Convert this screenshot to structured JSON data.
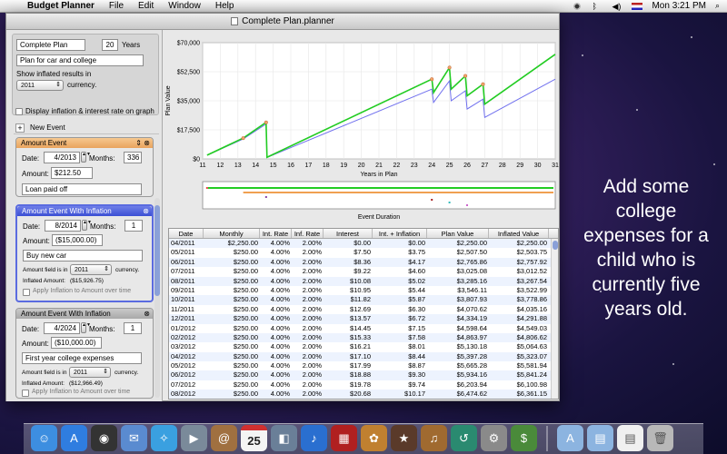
{
  "menubar": {
    "app_name": "Budget Planner",
    "items": [
      "File",
      "Edit",
      "Window",
      "Help"
    ],
    "clock": "Mon 3:21 PM"
  },
  "window": {
    "title": "Complete Plan.planner"
  },
  "plan": {
    "name": "Complete Plan",
    "years_value": "20",
    "years_label": "Years",
    "description": "Plan for car and college",
    "inflated_label": "Show inflated results in",
    "inflated_year": "2011",
    "currency_label": "currency.",
    "display_inflation_label": "Display inflation & interest rate on graph",
    "new_event_label": "New Event"
  },
  "events": [
    {
      "type": "Amount Event",
      "date_label": "Date:",
      "date": "4/2013",
      "months_label": "Months:",
      "months": "336",
      "amount_label": "Amount:",
      "amount": "$212.50",
      "description": "Loan paid off"
    },
    {
      "type": "Amount Event With Inflation",
      "date_label": "Date:",
      "date": "8/2014",
      "months_label": "Months:",
      "months": "1",
      "amount_label": "Amount:",
      "amount": "($15,000.00)",
      "description": "Buy new car",
      "field_in_label": "Amount field is in",
      "field_year": "2011",
      "currency_label": "currency.",
      "inflated_amount_label": "Inflated Amount:",
      "inflated_amount": "($15,926.75)",
      "apply_label": "Apply Inflation to Amount over time"
    },
    {
      "type": "Amount Event With Inflation",
      "date_label": "Date:",
      "date": "4/2024",
      "months_label": "Months:",
      "months": "1",
      "amount_label": "Amount:",
      "amount": "($10,000.00)",
      "description": "First year college expenses",
      "field_in_label": "Amount field is in",
      "field_year": "2011",
      "currency_label": "currency.",
      "inflated_amount_label": "Inflated Amount:",
      "inflated_amount": "($12,966.49)",
      "apply_label": "Apply Inflation to Amount over time"
    }
  ],
  "chart_data": {
    "type": "line",
    "title": "",
    "xlabel": "Years in Plan",
    "ylabel": "Plan Value",
    "xlim": [
      11,
      31
    ],
    "ylim": [
      0,
      70000
    ],
    "x_ticks": [
      "11",
      "12",
      "13",
      "14",
      "15",
      "16",
      "17",
      "18",
      "19",
      "20",
      "21",
      "22",
      "23",
      "24",
      "25",
      "26",
      "27",
      "28",
      "29",
      "30",
      "31"
    ],
    "y_ticks": [
      "$0",
      "$17,500",
      "$35,000",
      "$52,500",
      "$70,000"
    ],
    "grid": true,
    "series": [
      {
        "color": "#22cc22",
        "x": [
          11.25,
          13.3,
          14.6,
          14.65,
          24.0,
          24.1,
          25.0,
          25.1,
          25.9,
          26.0,
          26.9,
          27.0,
          31.0
        ],
        "y": [
          2250,
          12500,
          22000,
          1000,
          48000,
          40000,
          55000,
          42000,
          50000,
          38000,
          45000,
          33000,
          63000
        ]
      },
      {
        "color": "#7070ee",
        "x": [
          11.25,
          13.3,
          14.6,
          14.65,
          24.0,
          24.1,
          25.0,
          25.1,
          25.9,
          26.0,
          26.9,
          27.0,
          31.0
        ],
        "y": [
          2250,
          12000,
          21000,
          900,
          42000,
          34000,
          47000,
          35000,
          41000,
          30000,
          36000,
          25000,
          48000
        ]
      }
    ],
    "event_chart": {
      "xlabel": "Event Duration"
    }
  },
  "table": {
    "columns": [
      "Date",
      "Monthly",
      "Int. Rate",
      "Inf. Rate",
      "Interest",
      "Int. + Inflation",
      "Plan Value",
      "Inflated Value"
    ],
    "rows": [
      [
        "04/2011",
        "$2,250.00",
        "4.00%",
        "2.00%",
        "$0.00",
        "$0.00",
        "$2,250.00",
        "$2,250.00"
      ],
      [
        "05/2011",
        "$250.00",
        "4.00%",
        "2.00%",
        "$7.50",
        "$3.75",
        "$2,507.50",
        "$2,503.75"
      ],
      [
        "06/2011",
        "$250.00",
        "4.00%",
        "2.00%",
        "$8.36",
        "$4.17",
        "$2,765.86",
        "$2,757.92"
      ],
      [
        "07/2011",
        "$250.00",
        "4.00%",
        "2.00%",
        "$9.22",
        "$4.60",
        "$3,025.08",
        "$3,012.52"
      ],
      [
        "08/2011",
        "$250.00",
        "4.00%",
        "2.00%",
        "$10.08",
        "$5.02",
        "$3,285.16",
        "$3,267.54"
      ],
      [
        "09/2011",
        "$250.00",
        "4.00%",
        "2.00%",
        "$10.95",
        "$5.44",
        "$3,546.11",
        "$3,522.99"
      ],
      [
        "10/2011",
        "$250.00",
        "4.00%",
        "2.00%",
        "$11.82",
        "$5.87",
        "$3,807.93",
        "$3,778.86"
      ],
      [
        "11/2011",
        "$250.00",
        "4.00%",
        "2.00%",
        "$12.69",
        "$6.30",
        "$4,070.62",
        "$4,035.16"
      ],
      [
        "12/2011",
        "$250.00",
        "4.00%",
        "2.00%",
        "$13.57",
        "$6.72",
        "$4,334.19",
        "$4,291.88"
      ],
      [
        "01/2012",
        "$250.00",
        "4.00%",
        "2.00%",
        "$14.45",
        "$7.15",
        "$4,598.64",
        "$4,549.03"
      ],
      [
        "02/2012",
        "$250.00",
        "4.00%",
        "2.00%",
        "$15.33",
        "$7.58",
        "$4,863.97",
        "$4,806.62"
      ],
      [
        "03/2012",
        "$250.00",
        "4.00%",
        "2.00%",
        "$16.21",
        "$8.01",
        "$5,130.18",
        "$5,064.63"
      ],
      [
        "04/2012",
        "$250.00",
        "4.00%",
        "2.00%",
        "$17.10",
        "$8.44",
        "$5,397.28",
        "$5,323.07"
      ],
      [
        "05/2012",
        "$250.00",
        "4.00%",
        "2.00%",
        "$17.99",
        "$8.87",
        "$5,665.28",
        "$5,581.94"
      ],
      [
        "06/2012",
        "$250.00",
        "4.00%",
        "2.00%",
        "$18.88",
        "$9.30",
        "$5,934.16",
        "$5,841.24"
      ],
      [
        "07/2012",
        "$250.00",
        "4.00%",
        "2.00%",
        "$19.78",
        "$9.74",
        "$6,203.94",
        "$6,100.98"
      ],
      [
        "08/2012",
        "$250.00",
        "4.00%",
        "2.00%",
        "$20.68",
        "$10.17",
        "$6,474.62",
        "$6,361.15"
      ],
      [
        "09/2012",
        "$250.00",
        "4.00%",
        "2.00%",
        "$21.58",
        "$10.60",
        "$6,746.20",
        "$6,621.75"
      ],
      [
        "10/2012",
        "$250.00",
        "4.00%",
        "2.00%",
        "$22.49",
        "$11.04",
        "$7,018.69",
        "$6,882.79"
      ]
    ]
  },
  "caption": [
    "Add some",
    "college",
    "expenses for a",
    "child who is",
    "currently five",
    "years old."
  ],
  "dock": {
    "items": [
      "finder-icon",
      "app-store-icon",
      "dashboard-icon",
      "mail-icon",
      "safari-icon",
      "facetime-icon",
      "address-book-icon",
      "ical-icon",
      "preview-icon",
      "itunes-icon",
      "photo-booth-icon",
      "iphoto-icon",
      "imovie-icon",
      "garageband-icon",
      "time-machine-icon",
      "system-preferences-icon",
      "budget-planner-icon",
      "applications-folder-icon",
      "documents-folder-icon",
      "downloads-stack-icon",
      "trash-icon"
    ],
    "calendar_day": "25"
  }
}
